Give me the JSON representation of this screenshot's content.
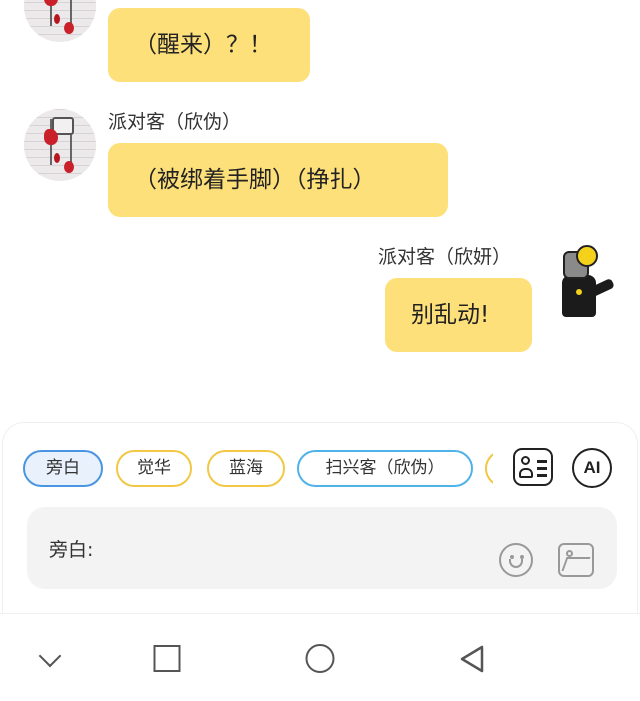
{
  "messages": [
    {
      "speaker": "",
      "text": "（醒来）？！"
    },
    {
      "speaker": "派对客（欣伪）",
      "text": "（被绑着手脚）（挣扎）"
    },
    {
      "speaker": "派对客（欣妍）",
      "text": "别乱动!"
    }
  ],
  "composer": {
    "chips": [
      "旁白",
      "觉华",
      "蓝海",
      "扫兴客（欣伪）"
    ],
    "selected_chip": "旁白",
    "ai_label": "AI",
    "input_prefix": "旁白:"
  },
  "icons": {
    "character_card": "character-card-icon",
    "ai": "ai-icon",
    "emoji": "smile-icon",
    "image": "image-icon"
  },
  "colors": {
    "bubble": "#fde07a",
    "chip_selected": "#4a95e2",
    "chip_yellow": "#f2c744",
    "chip_blue": "#4fb2e8"
  }
}
